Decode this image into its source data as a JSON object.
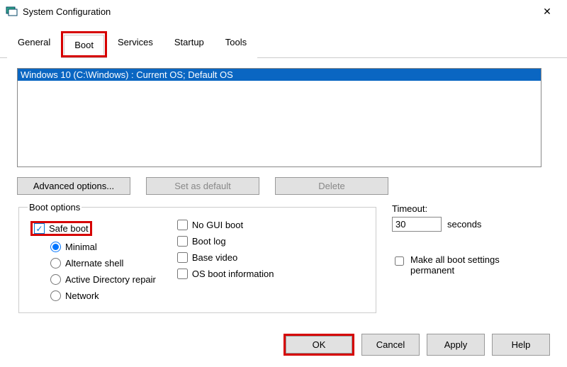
{
  "window": {
    "title": "System Configuration"
  },
  "tabs": {
    "general": "General",
    "boot": "Boot",
    "services": "Services",
    "startup": "Startup",
    "tools": "Tools",
    "active": "boot"
  },
  "bootList": {
    "items": [
      "Windows 10 (C:\\Windows) : Current OS; Default OS"
    ]
  },
  "buttons": {
    "advanced": "Advanced options...",
    "setDefault": "Set as default",
    "delete": "Delete",
    "ok": "OK",
    "cancel": "Cancel",
    "apply": "Apply",
    "help": "Help"
  },
  "bootOptions": {
    "legend": "Boot options",
    "safeBoot": {
      "label": "Safe boot",
      "checked": true
    },
    "radios": {
      "minimal": "Minimal",
      "altShell": "Alternate shell",
      "adRepair": "Active Directory repair",
      "network": "Network",
      "selected": "minimal"
    },
    "flags": {
      "noGui": "No GUI boot",
      "bootLog": "Boot log",
      "baseVideo": "Base video",
      "osInfo": "OS boot information"
    }
  },
  "timeout": {
    "label": "Timeout:",
    "value": "30",
    "unit": "seconds"
  },
  "permanent": {
    "label": "Make all boot settings permanent",
    "checked": false
  }
}
